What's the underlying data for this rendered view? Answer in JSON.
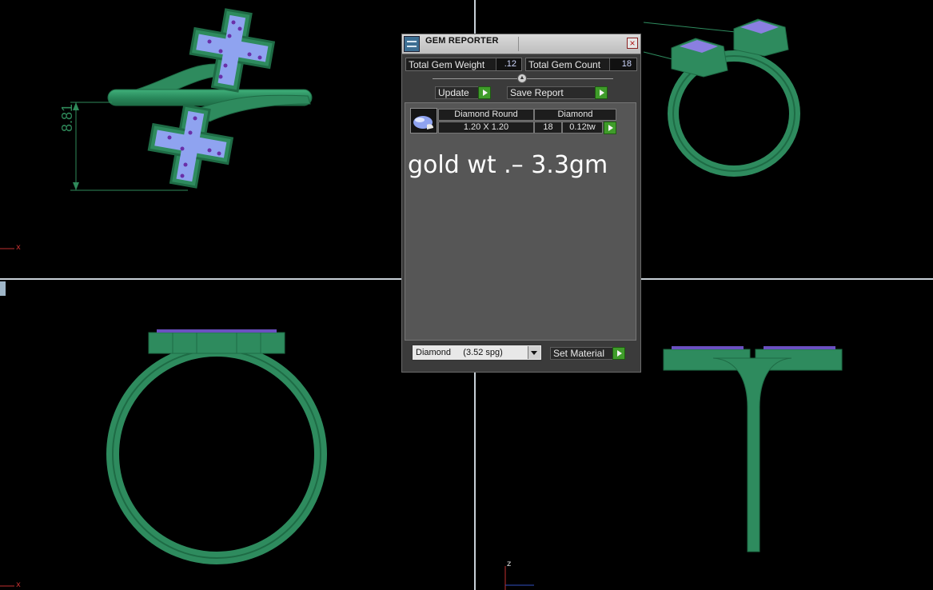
{
  "viewports": {
    "top_left": {
      "dimension_text": "8.81",
      "axis_x_label": "x"
    },
    "bottom_left": {
      "axis_x_label": "x"
    },
    "bottom_right": {
      "axis_z_label": "z"
    }
  },
  "gem_reporter": {
    "title": "GEM REPORTER",
    "close_glyph": "×",
    "total_gem_weight_label": "Total Gem Weight",
    "total_gem_weight_value": ".12",
    "total_gem_count_label": "Total Gem Count",
    "total_gem_count_value": "18",
    "update_label": "Update",
    "save_report_label": "Save Report",
    "table": {
      "headers": [
        "Diamond Round",
        "Diamond"
      ],
      "row": {
        "size": "1.20 X 1.20",
        "count": "18",
        "weight": "0.12tw"
      }
    },
    "note_text": "gold wt .– 3.3gm",
    "material_select_value": "Diamond     (3.52 spg)",
    "set_material_label": "Set Material"
  },
  "colors": {
    "metal": "#2e8b5e",
    "gem_fill": "#8fa3f0",
    "gem_prong": "#6a2fa8",
    "accent_button": "#3f9c2a"
  }
}
